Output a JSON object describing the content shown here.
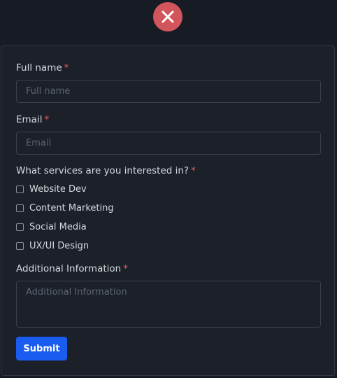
{
  "modal": {
    "close_icon": "close-icon",
    "close_color": "#d1555b"
  },
  "form": {
    "full_name": {
      "label": "Full name",
      "required_mark": "*",
      "placeholder": "Full name",
      "value": ""
    },
    "email": {
      "label": "Email",
      "required_mark": "*",
      "placeholder": "Email",
      "value": ""
    },
    "services": {
      "label": "What services are you interested in?",
      "required_mark": "*",
      "options": [
        {
          "label": "Website Dev",
          "checked": false
        },
        {
          "label": "Content Marketing",
          "checked": false
        },
        {
          "label": "Social Media",
          "checked": false
        },
        {
          "label": "UX/UI Design",
          "checked": false
        }
      ]
    },
    "additional_info": {
      "label": "Additional Information",
      "required_mark": "*",
      "placeholder": "Additional Information",
      "value": ""
    },
    "submit_label": "Submit",
    "submit_color": "#1a5cf0"
  }
}
